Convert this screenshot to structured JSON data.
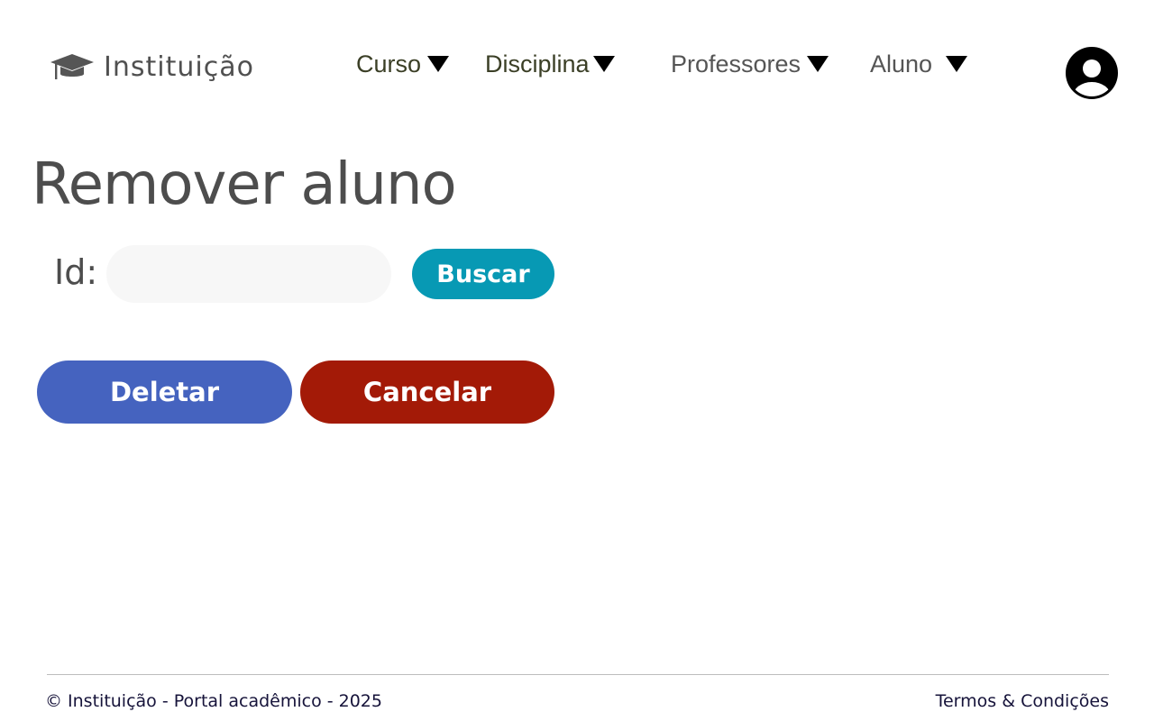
{
  "header": {
    "brand": "Instituição",
    "nav": [
      {
        "label": "Curso"
      },
      {
        "label": "Disciplina"
      },
      {
        "label": "Professores"
      },
      {
        "label": "Aluno"
      }
    ]
  },
  "main": {
    "title": "Remover aluno",
    "id_label": "Id:",
    "id_value": "",
    "search_label": "Buscar",
    "delete_label": "Deletar",
    "cancel_label": "Cancelar"
  },
  "footer": {
    "copyright": "© Instituição - Portal acadêmico - 2025",
    "terms": "Termos & Condições"
  },
  "colors": {
    "search": "#0799b4",
    "delete": "#4563bf",
    "cancel": "#a31a07"
  },
  "icons": {
    "brand": "graduation-cap-icon",
    "dropdown": "triangle-down-icon",
    "user": "user-circle-icon"
  }
}
